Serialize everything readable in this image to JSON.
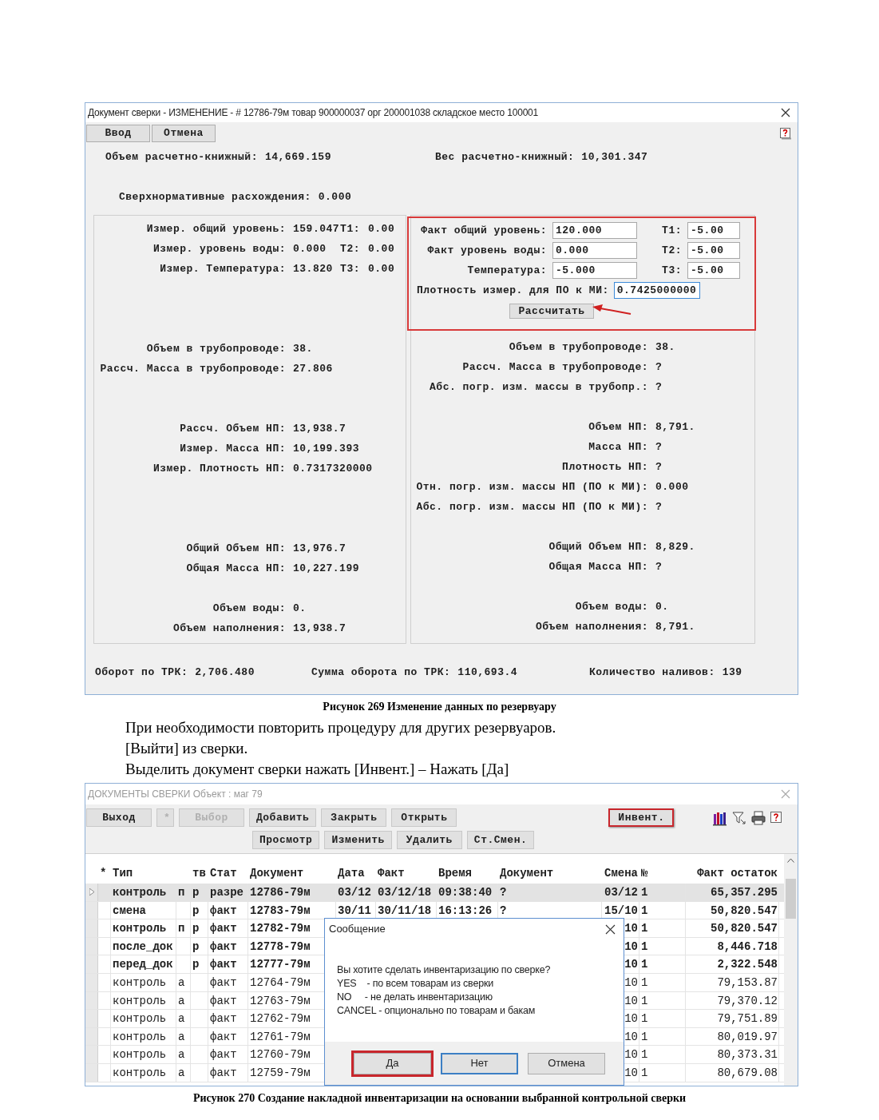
{
  "doc_window": {
    "title": "Документ сверки - ИЗМЕНЕНИЕ -  # 12786-79м товар 900000037 орг 200001038 складское место 100001",
    "buttons": [
      {
        "label": "Ввод"
      },
      {
        "label": "Отмена"
      }
    ],
    "book_volume": {
      "label": "Объем расчетно-книжный:",
      "value": "14,669.159"
    },
    "book_weight": {
      "label": "Вес расчетно-книжный:",
      "value": "10,301.347"
    },
    "surplus": {
      "label": "Сверхнормативные расхождения:",
      "value": "0.000"
    },
    "measured_panel": {
      "levels": [
        {
          "label": "Измер. общий уровень:",
          "value": "159.047",
          "t_label": "T1:",
          "t_value": "0.00"
        },
        {
          "label": "Измер. уровень воды:",
          "value": "0.000",
          "t_label": "T2:",
          "t_value": "0.00"
        },
        {
          "label": "Измер. Температура:",
          "value": "13.820",
          "t_label": "T3:",
          "t_value": "0.00"
        }
      ],
      "groups": [
        [
          {
            "label": "Объем в трубопроводе:",
            "value": "38."
          },
          {
            "label": "Рассч. Масса в трубопроводе:",
            "value": "27.806"
          }
        ],
        [
          {
            "label": "Рассч. Объем НП:",
            "value": "13,938.7"
          },
          {
            "label": "Измер. Масса НП:",
            "value": "10,199.393"
          },
          {
            "label": "Измер. Плотность НП:",
            "value": "0.7317320000"
          }
        ],
        [
          {
            "label": "Общий Объем НП:",
            "value": "13,976.7"
          },
          {
            "label": "Общая Масса НП:",
            "value": "10,227.199"
          }
        ],
        [
          {
            "label": "Объем воды:",
            "value": "0."
          },
          {
            "label": "Объем наполнения:",
            "value": "13,938.7"
          }
        ]
      ]
    },
    "fact_panel": {
      "highlighted": true,
      "inputs": [
        {
          "label": "Факт общий уровень:",
          "value": "120.000",
          "t_label": "T1:",
          "t_value": "-5.00"
        },
        {
          "label": "Факт уровень воды:",
          "value": "0.000",
          "t_label": "T2:",
          "t_value": "-5.00"
        },
        {
          "label": "Температура:",
          "value": "-5.000",
          "t_label": "T3:",
          "t_value": "-5.00"
        }
      ],
      "density": {
        "label": "Плотность измер. для ПО к МИ:",
        "value": "0.7425000000",
        "focused": true
      },
      "calc_button": "Рассчитать",
      "groups": [
        [
          {
            "label": "Объем в трубопроводе:",
            "value": "38."
          },
          {
            "label": "Рассч. Масса в трубопроводе:",
            "value": "?"
          },
          {
            "label": "Абс. погр. изм. массы в трубопр.:",
            "value": "?"
          }
        ],
        [
          {
            "label": "Объем НП:",
            "value": "8,791."
          },
          {
            "label": "Масса НП:",
            "value": "?"
          },
          {
            "label": "Плотность НП:",
            "value": "?"
          },
          {
            "label": "Отн. погр. изм. массы НП (ПО к МИ):",
            "value": "0.000"
          },
          {
            "label": "Абс. погр. изм. массы НП (ПО к МИ):",
            "value": "?"
          }
        ],
        [
          {
            "label": "Общий Объем НП:",
            "value": "8,829."
          },
          {
            "label": "Общая Масса НП:",
            "value": "?"
          }
        ],
        [
          {
            "label": "Объем воды:",
            "value": "0."
          },
          {
            "label": "Объем наполнения:",
            "value": "8,791."
          }
        ]
      ]
    },
    "totals": [
      {
        "label": "Оборот по ТРК:",
        "value": "2,706.480"
      },
      {
        "label": "Сумма оборота по ТРК:",
        "value": "110,693.4"
      },
      {
        "label": "Количество наливов:",
        "value": "139"
      }
    ]
  },
  "caption_1": "Рисунок 269 Изменение данных по резервуару",
  "instructions": [
    "При необходимости повторить процедуру для других резервуаров.",
    "[Выйти] из сверки.",
    "Выделить документ сверки нажать [Инвент.] – Нажать [Да]"
  ],
  "list_window": {
    "title": "ДОКУМЕНТЫ СВЕРКИ Объект : маг 79",
    "toolbar_row_1": [
      {
        "label": "Выход",
        "disabled": false,
        "highlighted": false
      },
      {
        "label": "*",
        "disabled": true,
        "highlighted": false
      },
      {
        "label": "Выбор",
        "disabled": true,
        "highlighted": false
      },
      {
        "label": "Добавить",
        "disabled": false,
        "highlighted": false
      },
      {
        "label": "Закрыть",
        "disabled": false,
        "highlighted": false
      },
      {
        "label": "Открыть",
        "disabled": false,
        "highlighted": false
      }
    ],
    "inventory_button": {
      "label": "Инвент.",
      "highlighted": true
    },
    "toolbar_row_2": [
      {
        "label": "Просмотр",
        "disabled": false,
        "highlighted": false
      },
      {
        "label": "Изменить",
        "disabled": false,
        "highlighted": false
      },
      {
        "label": "Удалить",
        "disabled": false,
        "highlighted": false
      },
      {
        "label": "Ст.Смен.",
        "disabled": false,
        "highlighted": false
      }
    ],
    "columns": [
      "*",
      "Тип",
      "тв",
      "Стат",
      "Документ",
      "Дата",
      "Факт",
      "Время",
      "Документ",
      "Смена",
      "№",
      "Факт остаток"
    ],
    "rows": [
      {
        "selected": true,
        "dimmed": false,
        "type": "контроль",
        "column_3": "п",
        "tv": "р",
        "status": "разре",
        "document": "12786-79м",
        "date": "03/12",
        "fact": "03/12/18",
        "time": "09:38:40",
        "document_2": "?",
        "shift": "03/12",
        "number": "1",
        "fact_balance": "65,357.295"
      },
      {
        "selected": false,
        "dimmed": false,
        "type": "смена",
        "tv": "р",
        "status": "факт",
        "document": "12783-79м",
        "date": "30/11",
        "fact": "30/11/18",
        "time": "16:13:26",
        "document_2": "?",
        "shift": "15/10",
        "number": "1",
        "fact_balance": "50,820.547"
      },
      {
        "selected": false,
        "dimmed": false,
        "type": "контроль",
        "column_3": "п",
        "tv": "р",
        "status": "факт",
        "document": "12782-79м",
        "shift": "10",
        "number": "1",
        "fact_balance": "50,820.547"
      },
      {
        "selected": false,
        "dimmed": false,
        "type": "после_док",
        "tv": "р",
        "status": "факт",
        "document": "12778-79м",
        "shift": "10",
        "number": "1",
        "fact_balance": "8,446.718"
      },
      {
        "selected": false,
        "dimmed": false,
        "type": "перед_док",
        "tv": "р",
        "status": "факт",
        "document": "12777-79м",
        "shift": "10",
        "number": "1",
        "fact_balance": "2,322.548"
      },
      {
        "selected": false,
        "dimmed": true,
        "type": "контроль",
        "column_3": "а",
        "status": "факт",
        "document": "12764-79м",
        "shift": "10",
        "number": "1",
        "fact_balance": "79,153.87"
      },
      {
        "selected": false,
        "dimmed": true,
        "type": "контроль",
        "column_3": "а",
        "status": "факт",
        "document": "12763-79м",
        "shift": "10",
        "number": "1",
        "fact_balance": "79,370.12"
      },
      {
        "selected": false,
        "dimmed": true,
        "type": "контроль",
        "column_3": "а",
        "status": "факт",
        "document": "12762-79м",
        "shift": "10",
        "number": "1",
        "fact_balance": "79,751.89"
      },
      {
        "selected": false,
        "dimmed": true,
        "type": "контроль",
        "column_3": "а",
        "status": "факт",
        "document": "12761-79м",
        "shift": "10",
        "number": "1",
        "fact_balance": "80,019.97"
      },
      {
        "selected": false,
        "dimmed": true,
        "type": "контроль",
        "column_3": "а",
        "status": "факт",
        "document": "12760-79м",
        "shift": "10",
        "number": "1",
        "fact_balance": "80,373.31"
      },
      {
        "selected": false,
        "dimmed": true,
        "type": "контроль",
        "column_3": "а",
        "status": "факт",
        "document": "12759-79м",
        "shift": "10",
        "number": "1",
        "fact_balance": "80,679.08"
      }
    ],
    "dialog": {
      "title": "Сообщение",
      "message": [
        "Вы хотите сделать инвентаризацию по сверке?",
        "YES    - по всем товарам из сверки",
        "NO     - не делать инвентаризацию",
        "CANCEL - опционально по товарам и бакам"
      ],
      "buttons": [
        {
          "label": "Да",
          "highlighted": true,
          "focused": false
        },
        {
          "label": "Нет",
          "highlighted": false,
          "focused": true
        },
        {
          "label": "Отмена",
          "highlighted": false,
          "focused": false
        }
      ]
    }
  },
  "caption_2": "Рисунок 270 Создание накладной инвентаризации на основании выбранной контрольной сверки"
}
